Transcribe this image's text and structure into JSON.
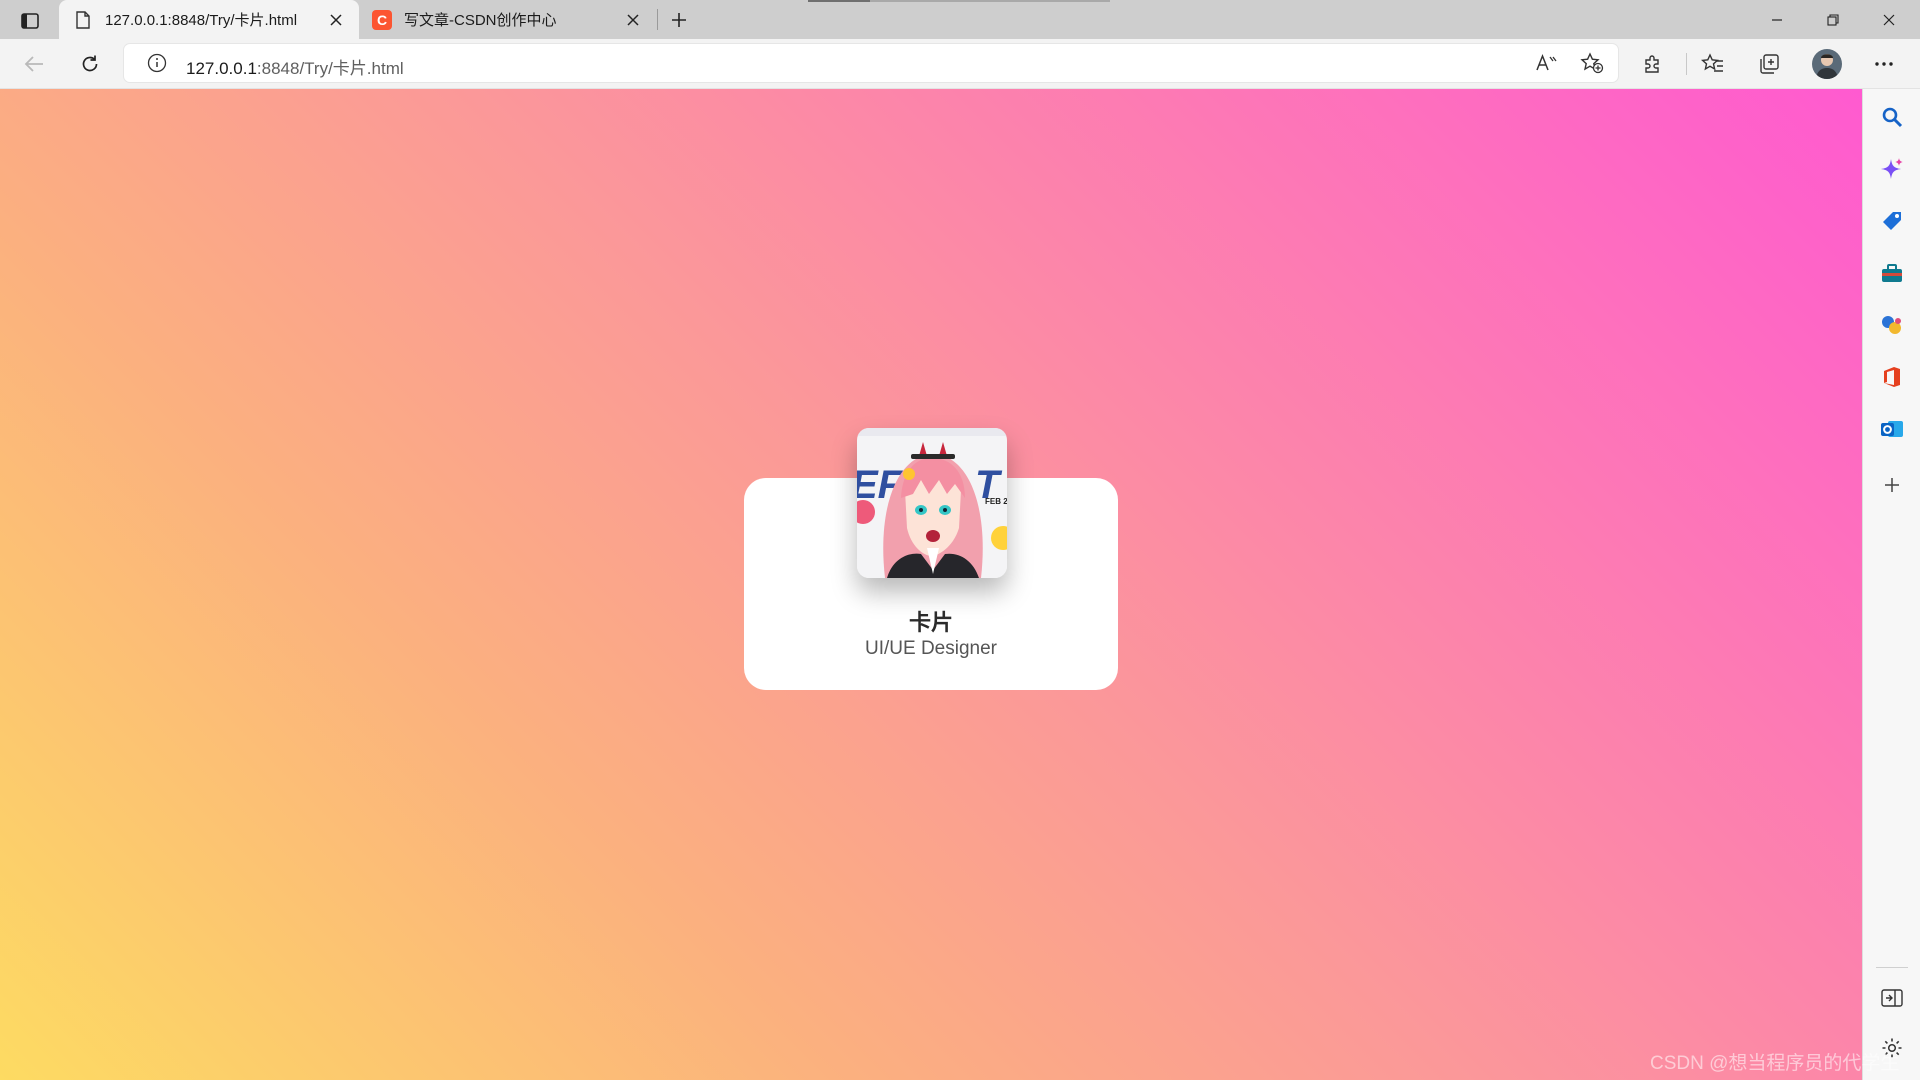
{
  "tabs": [
    {
      "title": "127.0.0.1:8848/Try/卡片.html",
      "active": true,
      "icon": "page-icon"
    },
    {
      "title": "写文章-CSDN创作中心",
      "active": false,
      "icon": "csdn-icon",
      "icon_color": "#fc5531"
    }
  ],
  "address_bar": {
    "url_host": "127.0.0.1",
    "url_rest": ":8848/Try/卡片.html"
  },
  "page": {
    "card": {
      "name": "卡片",
      "role": "UI/UE Designer"
    },
    "gradient_colors": [
      "#fddb62",
      "#fbb07f",
      "#fb979a",
      "#ff5ad0"
    ]
  },
  "sidebar": {
    "items": [
      "search-icon",
      "copilot-icon",
      "tag-icon",
      "tools-icon",
      "games-icon",
      "office-icon",
      "outlook-icon",
      "add-icon"
    ],
    "bottom": [
      "sidebar-collapse-icon",
      "settings-icon"
    ]
  },
  "watermark": "CSDN @想当程序员的代学生"
}
